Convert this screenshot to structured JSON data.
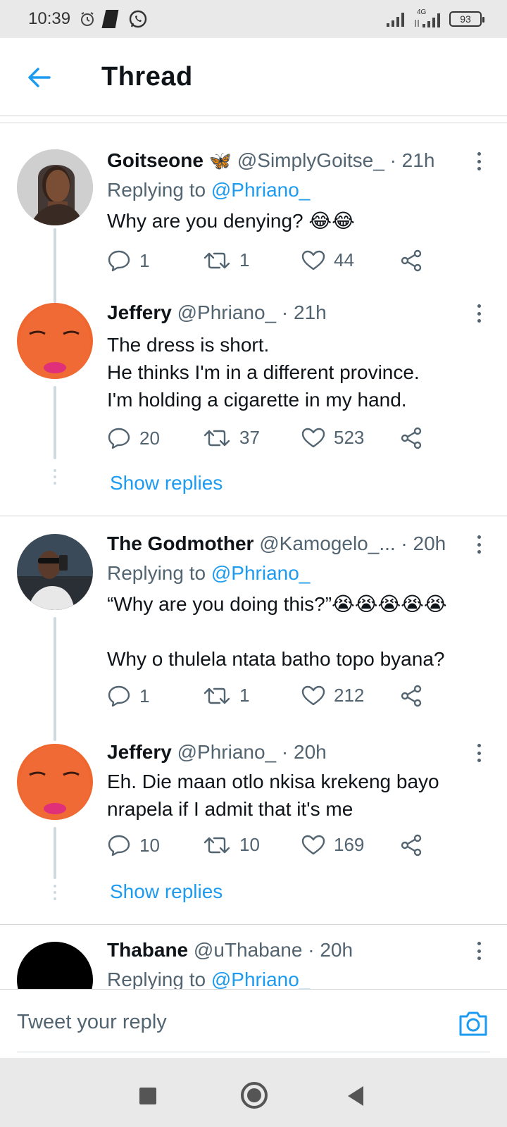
{
  "status_bar": {
    "time": "10:39",
    "net_label": "4G",
    "battery": "93"
  },
  "header": {
    "title": "Thread",
    "back_icon": "arrow-left-icon"
  },
  "tweets": [
    {
      "name": "Goitseone",
      "emoji": "🦋",
      "handle": "@SimplyGoitse_ · 21h",
      "replying_prefix": "Replying to ",
      "replying_to": "@Phriano_",
      "text": "Why are you denying? 😂😂",
      "replies": "1",
      "retweets": "1",
      "likes": "44"
    },
    {
      "name": "Jeffery",
      "handle": "@Phriano_ · 21h",
      "text": "The dress is short.\nHe thinks I'm in a different province.\nI'm holding a cigarette in my hand.",
      "replies": "20",
      "retweets": "37",
      "likes": "523",
      "show_replies": "Show replies"
    },
    {
      "name": "The Godmother",
      "handle": "@Kamogelo_...  · 20h",
      "replying_prefix": "Replying to ",
      "replying_to": "@Phriano_",
      "text": "“Why are you doing this?”😭😭😭😭😭\n\nWhy o thulela ntata batho topo byana?",
      "replies": "1",
      "retweets": "1",
      "likes": "212"
    },
    {
      "name": "Jeffery",
      "handle": "@Phriano_ · 20h",
      "text": "Eh. Die maan otlo nkisa krekeng bayo\nnrapela if I admit that it's me",
      "replies": "10",
      "retweets": "10",
      "likes": "169",
      "show_replies": "Show replies"
    },
    {
      "name": "Thabane",
      "handle": "@uThabane · 20h",
      "replying_prefix": "Replying to ",
      "replying_to": "@Phriano_"
    }
  ],
  "reply_bar": {
    "placeholder": "Tweet your reply",
    "camera_icon": "camera-icon"
  },
  "colors": {
    "accent": "#1d9bf0",
    "secondary_text": "#536471",
    "thread_line": "#cfd9de"
  }
}
